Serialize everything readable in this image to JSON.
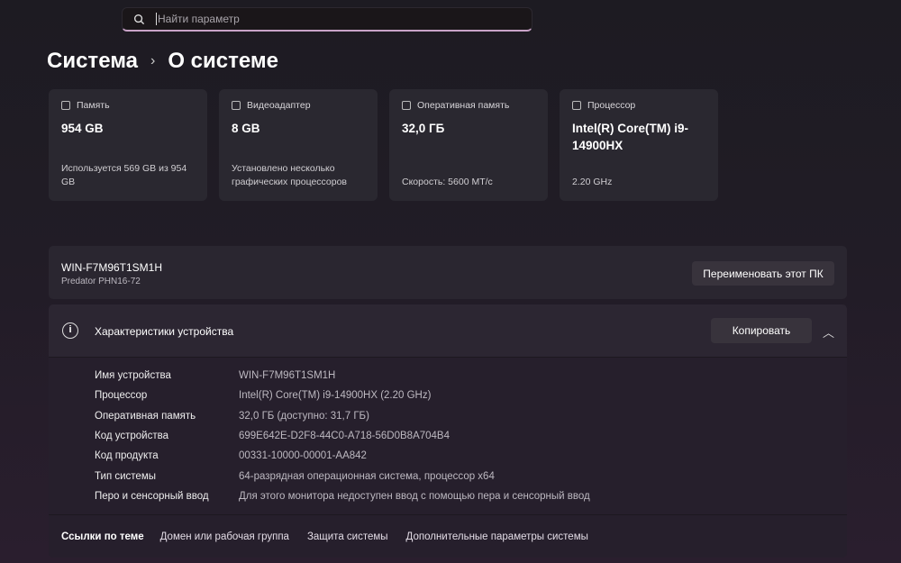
{
  "search": {
    "placeholder": "Найти параметр"
  },
  "breadcrumb": {
    "parent": "Система",
    "separator": "›",
    "current": "О системе"
  },
  "cards": [
    {
      "label": "Память",
      "value": "954 GB",
      "sub": "Используется 569 GB из 954 GB"
    },
    {
      "label": "Видеоадаптер",
      "value": "8 GB",
      "sub": "Установлено несколько графических процессоров"
    },
    {
      "label": "Оперативная память",
      "value": "32,0 ГБ",
      "sub": "Скорость: 5600 МТ/с"
    },
    {
      "label": "Процессор",
      "value": "Intel(R) Core(TM) i9-14900HX",
      "sub": "2.20 GHz"
    }
  ],
  "pc": {
    "name": "WIN-F7M96T1SM1H",
    "model": "Predator PHN16-72",
    "rename_label": "Переименовать этот ПК"
  },
  "specs": {
    "title": "Характеристики устройства",
    "copy_label": "Копировать",
    "rows": [
      {
        "k": "Имя устройства",
        "v": "WIN-F7M96T1SM1H"
      },
      {
        "k": "Процессор",
        "v": "Intel(R) Core(TM) i9-14900HX (2.20 GHz)"
      },
      {
        "k": "Оперативная память",
        "v": "32,0 ГБ (доступно: 31,7 ГБ)"
      },
      {
        "k": "Код устройства",
        "v": "699E642E-D2F8-44C0-A718-56D0B8A704B4"
      },
      {
        "k": "Код продукта",
        "v": "00331-10000-00001-AA842"
      },
      {
        "k": "Тип системы",
        "v": "64-разрядная операционная система, процессор x64"
      },
      {
        "k": "Перо и сенсорный ввод",
        "v": "Для этого монитора недоступен ввод с помощью пера и сенсорный ввод"
      }
    ]
  },
  "links": {
    "label": "Ссылки по теме",
    "items": [
      "Домен или рабочая группа",
      "Защита системы",
      "Дополнительные параметры системы"
    ]
  }
}
